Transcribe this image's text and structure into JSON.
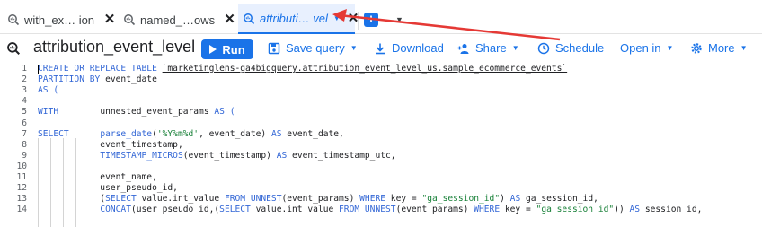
{
  "tabs": [
    {
      "label": "with_ex… ion",
      "icon": "query-icon",
      "active": false
    },
    {
      "label": "named_…ows",
      "icon": "query-icon",
      "active": false
    },
    {
      "label": "attributi… vel",
      "icon": "query-icon",
      "active": true
    }
  ],
  "toolbar": {
    "title": "attribution_event_level",
    "run_label": "Run",
    "save_label": "Save query",
    "download_label": "Download",
    "share_label": "Share",
    "schedule_label": "Schedule",
    "open_in_label": "Open in",
    "more_label": "More"
  },
  "colors": {
    "accent": "#1a73e8",
    "keyword": "#3367d6",
    "string": "#188038",
    "annotation_arrow": "#e53935"
  },
  "editor": {
    "lines": [
      {
        "num": "1",
        "tokens": [
          {
            "t": "CREATE OR REPLACE TABLE ",
            "c": "kw"
          },
          {
            "t": "`marketinglens-ga4bigquery.attribution_event_level_us.sample_ecommerce_events`",
            "c": "ref"
          }
        ]
      },
      {
        "num": "2",
        "tokens": [
          {
            "t": "PARTITION BY ",
            "c": "kw"
          },
          {
            "t": "event_date",
            "c": ""
          }
        ]
      },
      {
        "num": "3",
        "tokens": [
          {
            "t": "AS (",
            "c": "kw"
          }
        ]
      },
      {
        "num": "4",
        "tokens": []
      },
      {
        "num": "5",
        "tokens": [
          {
            "t": "WITH",
            "c": "kw"
          },
          {
            "t": "        unnested_event_params ",
            "c": ""
          },
          {
            "t": "AS (",
            "c": "kw"
          }
        ]
      },
      {
        "num": "6",
        "tokens": []
      },
      {
        "num": "7",
        "tokens": [
          {
            "t": "SELECT",
            "c": "kw"
          },
          {
            "t": "      ",
            "c": ""
          },
          {
            "t": "parse_date",
            "c": "fn"
          },
          {
            "t": "(",
            "c": ""
          },
          {
            "t": "'%Y%m%d'",
            "c": "str"
          },
          {
            "t": ", event_date) ",
            "c": ""
          },
          {
            "t": "AS",
            "c": "kw"
          },
          {
            "t": " event_date,",
            "c": ""
          }
        ]
      },
      {
        "num": "8",
        "tokens": [
          {
            "t": "            event_timestamp,",
            "c": ""
          }
        ]
      },
      {
        "num": "9",
        "tokens": [
          {
            "t": "            ",
            "c": ""
          },
          {
            "t": "TIMESTAMP_MICROS",
            "c": "fn"
          },
          {
            "t": "(event_timestamp) ",
            "c": ""
          },
          {
            "t": "AS",
            "c": "kw"
          },
          {
            "t": " event_timestamp_utc,",
            "c": ""
          }
        ]
      },
      {
        "num": "10",
        "tokens": []
      },
      {
        "num": "11",
        "tokens": [
          {
            "t": "            event_name,",
            "c": ""
          }
        ]
      },
      {
        "num": "12",
        "tokens": [
          {
            "t": "            user_pseudo_id,",
            "c": ""
          }
        ]
      },
      {
        "num": "13",
        "tokens": [
          {
            "t": "            (",
            "c": ""
          },
          {
            "t": "SELECT",
            "c": "kw"
          },
          {
            "t": " value.int_value ",
            "c": ""
          },
          {
            "t": "FROM UNNEST",
            "c": "kw"
          },
          {
            "t": "(event_params) ",
            "c": ""
          },
          {
            "t": "WHERE",
            "c": "kw"
          },
          {
            "t": " key = ",
            "c": ""
          },
          {
            "t": "\"ga_session_id\"",
            "c": "str"
          },
          {
            "t": ") ",
            "c": ""
          },
          {
            "t": "AS",
            "c": "kw"
          },
          {
            "t": " ga_session_id,",
            "c": ""
          }
        ]
      },
      {
        "num": "14",
        "tokens": [
          {
            "t": "            ",
            "c": ""
          },
          {
            "t": "CONCAT",
            "c": "fn"
          },
          {
            "t": "(user_pseudo_id,(",
            "c": ""
          },
          {
            "t": "SELECT",
            "c": "kw"
          },
          {
            "t": " value.int_value ",
            "c": ""
          },
          {
            "t": "FROM UNNEST",
            "c": "kw"
          },
          {
            "t": "(event_params) ",
            "c": ""
          },
          {
            "t": "WHERE",
            "c": "kw"
          },
          {
            "t": " key = ",
            "c": ""
          },
          {
            "t": "\"ga_session_id\"",
            "c": "str"
          },
          {
            "t": ")) ",
            "c": ""
          },
          {
            "t": "AS",
            "c": "kw"
          },
          {
            "t": " session_id,",
            "c": ""
          }
        ]
      }
    ]
  }
}
